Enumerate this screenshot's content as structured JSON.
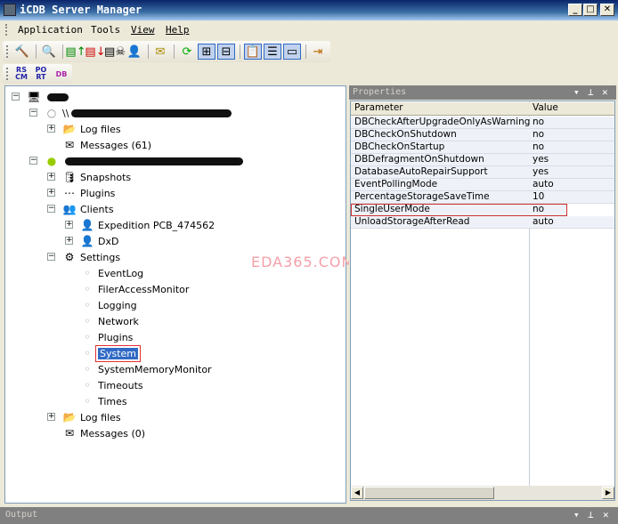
{
  "window": {
    "title": "iCDB Server Manager",
    "minimize": "_",
    "maximize": "□",
    "close": "✕"
  },
  "menu": [
    "Application",
    "Tools",
    "View",
    "Help"
  ],
  "toolbar2": {
    "rscm": "RS CM",
    "port": "PO RT",
    "db": "DB"
  },
  "tree": [
    {
      "level": 0,
      "label": "",
      "blur": 24,
      "icon": "computer-icon",
      "glyph": "🖥",
      "exp": "-"
    },
    {
      "level": 1,
      "label": "\\\\",
      "blur": 180,
      "icon": "server-offline-icon",
      "glyph": "○",
      "exp": "-"
    },
    {
      "level": 2,
      "label": "Log files",
      "icon": "log-files-icon",
      "glyph": "📂",
      "exp": "+"
    },
    {
      "level": 2,
      "label": "Messages (61)",
      "icon": "envelope-icon",
      "glyph": "✉",
      "exp": ""
    },
    {
      "level": 1,
      "label": "",
      "blur": 200,
      "icon": "server-online-icon",
      "glyph": "●",
      "exp": "-"
    },
    {
      "level": 2,
      "label": "Snapshots",
      "icon": "snapshots-icon",
      "glyph": "🛢",
      "exp": "+"
    },
    {
      "level": 2,
      "label": "Plugins",
      "icon": "plugins-icon",
      "glyph": "⋯",
      "exp": "+"
    },
    {
      "level": 2,
      "label": "Clients",
      "icon": "clients-icon",
      "glyph": "👥",
      "exp": "-"
    },
    {
      "level": 3,
      "label": "Expedition PCB_474562",
      "icon": "client-icon",
      "glyph": "👤",
      "exp": "+"
    },
    {
      "level": 3,
      "label": "DxD",
      "icon": "client-icon",
      "glyph": "👤",
      "exp": "+"
    },
    {
      "level": 2,
      "label": "Settings",
      "icon": "settings-icon",
      "glyph": "⚙",
      "exp": "-"
    },
    {
      "level": 3,
      "label": "EventLog",
      "icon": "bullet-icon",
      "glyph": "◦",
      "exp": ""
    },
    {
      "level": 3,
      "label": "FilerAccessMonitor",
      "icon": "bullet-icon",
      "glyph": "◦",
      "exp": ""
    },
    {
      "level": 3,
      "label": "Logging",
      "icon": "bullet-icon",
      "glyph": "◦",
      "exp": ""
    },
    {
      "level": 3,
      "label": "Network",
      "icon": "bullet-icon",
      "glyph": "◦",
      "exp": ""
    },
    {
      "level": 3,
      "label": "Plugins",
      "icon": "bullet-icon",
      "glyph": "◦",
      "exp": ""
    },
    {
      "level": 3,
      "label": "System",
      "icon": "bullet-icon",
      "glyph": "◦",
      "exp": "",
      "selected": true
    },
    {
      "level": 3,
      "label": "SystemMemoryMonitor",
      "icon": "bullet-icon",
      "glyph": "◦",
      "exp": ""
    },
    {
      "level": 3,
      "label": "Timeouts",
      "icon": "bullet-icon",
      "glyph": "◦",
      "exp": ""
    },
    {
      "level": 3,
      "label": "Times",
      "icon": "bullet-icon",
      "glyph": "◦",
      "exp": ""
    },
    {
      "level": 2,
      "label": "Log files",
      "icon": "log-files-icon",
      "glyph": "📂",
      "exp": "+"
    },
    {
      "level": 2,
      "label": "Messages (0)",
      "icon": "envelope-icon",
      "glyph": "✉",
      "exp": ""
    }
  ],
  "properties": {
    "title": "Properties",
    "columns": [
      "Parameter",
      "Value"
    ],
    "rows": [
      [
        "DBCheckAfterUpgradeOnlyAsWarning",
        "no"
      ],
      [
        "DBCheckOnShutdown",
        "no"
      ],
      [
        "DBCheckOnStartup",
        "no"
      ],
      [
        "DBDefragmentOnShutdown",
        "yes"
      ],
      [
        "DatabaseAutoRepairSupport",
        "yes"
      ],
      [
        "EventPollingMode",
        "auto"
      ],
      [
        "PercentageStorageSaveTime",
        "10"
      ],
      [
        "SingleUserMode",
        "no"
      ],
      [
        "UnloadStorageAfterRead",
        "auto"
      ]
    ],
    "highlighted_row": 7
  },
  "output": {
    "title": "Output"
  },
  "watermark": "EDA365.COM"
}
